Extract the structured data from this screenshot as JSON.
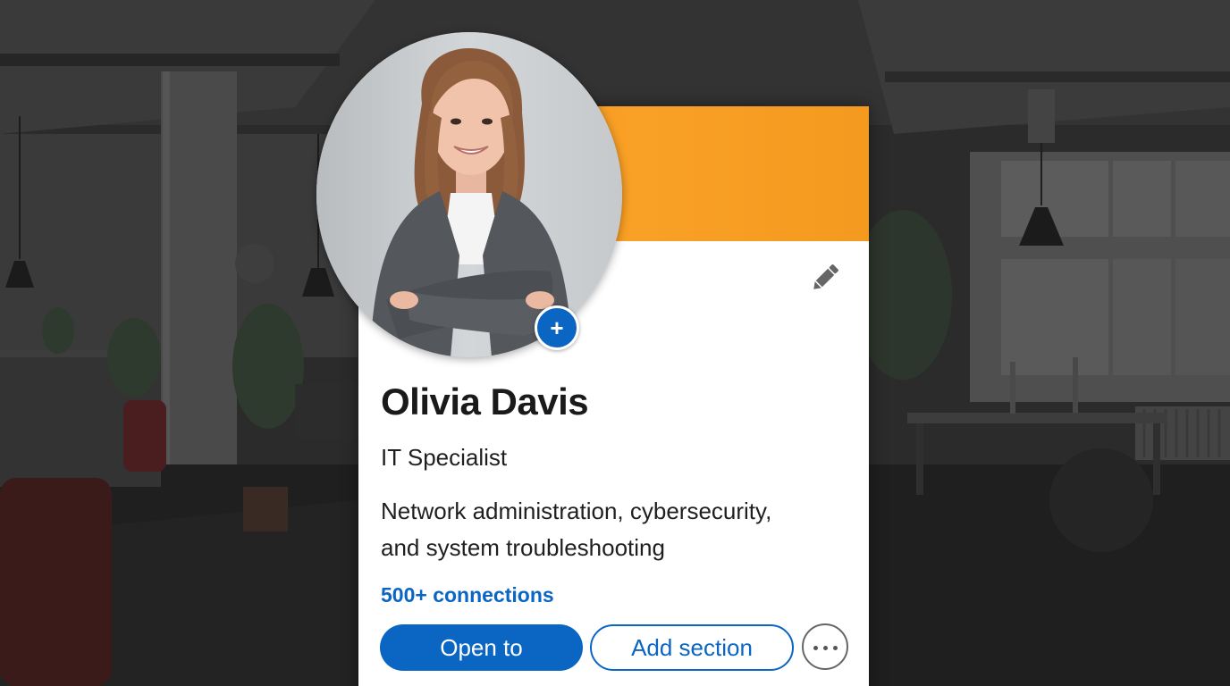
{
  "profile": {
    "name": "Olivia Davis",
    "headline": "IT Specialist",
    "about_line1": "Network administration, cybersecurity,",
    "about_line2": "and system troubleshooting",
    "connections": "500+ connections"
  },
  "actions": {
    "primary_label": "Open to",
    "secondary_label": "Add section",
    "more_label": "More actions",
    "add_photo_label": "+",
    "edit_icon": "pencil-icon"
  },
  "colors": {
    "accent": "#0a66c2",
    "cover": "#f7941d"
  }
}
